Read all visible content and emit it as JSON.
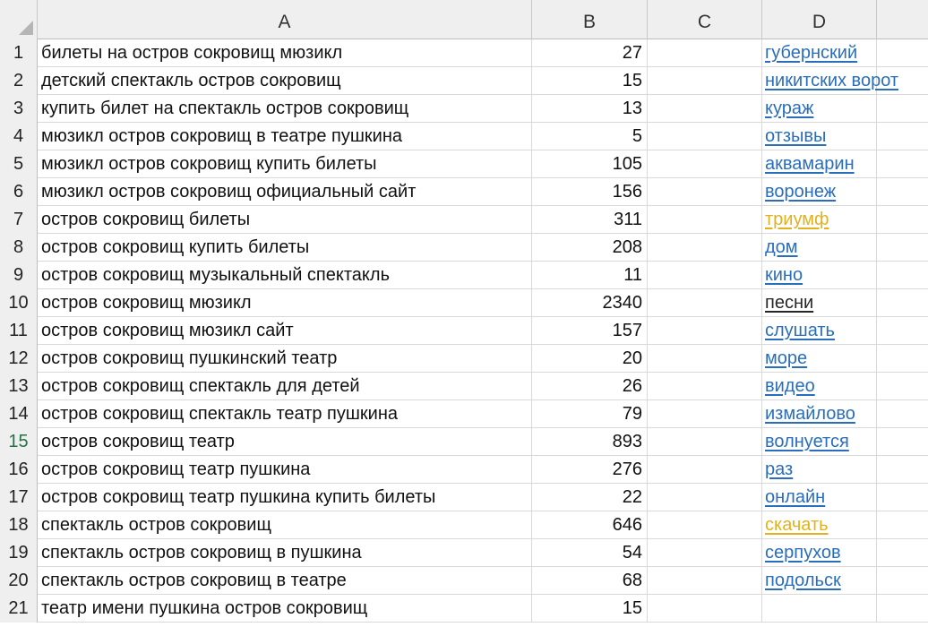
{
  "columns": [
    "",
    "A",
    "B",
    "C",
    "D",
    ""
  ],
  "active_row": 15,
  "colors": {
    "link_blue": "#2a6ebb",
    "link_gold": "#e2b21c",
    "link_dark": "#262626",
    "active_row_number": "#217346"
  },
  "rows": [
    {
      "num": "1",
      "a": "билеты на остров сокровищ мюзикл",
      "b": "27",
      "d": "губернский",
      "d_color": "#2a6ebb"
    },
    {
      "num": "2",
      "a": "детский спектакль остров сокровищ",
      "b": "15",
      "d": "никитских ворот",
      "d_color": "#2a6ebb"
    },
    {
      "num": "3",
      "a": "купить билет на спектакль остров сокровищ",
      "b": "13",
      "d": "кураж",
      "d_color": "#2a6ebb"
    },
    {
      "num": "4",
      "a": "мюзикл остров сокровищ в театре пушкина",
      "b": "5",
      "d": "отзывы",
      "d_color": "#2a6ebb"
    },
    {
      "num": "5",
      "a": "мюзикл остров сокровищ купить билеты",
      "b": "105",
      "d": "аквамарин",
      "d_color": "#2a6ebb"
    },
    {
      "num": "6",
      "a": "мюзикл остров сокровищ официальный сайт",
      "b": "156",
      "d": "воронеж",
      "d_color": "#2a6ebb"
    },
    {
      "num": "7",
      "a": "остров сокровищ билеты",
      "b": "311",
      "d": "триумф",
      "d_color": "#e2b21c"
    },
    {
      "num": "8",
      "a": "остров сокровищ купить билеты",
      "b": "208",
      "d": "дом",
      "d_color": "#2a6ebb"
    },
    {
      "num": "9",
      "a": "остров сокровищ музыкальный спектакль",
      "b": "11",
      "d": "кино",
      "d_color": "#2a6ebb"
    },
    {
      "num": "10",
      "a": "остров сокровищ мюзикл",
      "b": "2340",
      "d": "песни",
      "d_color": "#262626"
    },
    {
      "num": "11",
      "a": "остров сокровищ мюзикл сайт",
      "b": "157",
      "d": "слушать",
      "d_color": "#2a6ebb"
    },
    {
      "num": "12",
      "a": "остров сокровищ пушкинский театр",
      "b": "20",
      "d": "море",
      "d_color": "#2a6ebb"
    },
    {
      "num": "13",
      "a": "остров сокровищ спектакль для детей",
      "b": "26",
      "d": "видео",
      "d_color": "#2a6ebb"
    },
    {
      "num": "14",
      "a": "остров сокровищ спектакль театр пушкина",
      "b": "79",
      "d": "измайлово",
      "d_color": "#2a6ebb"
    },
    {
      "num": "15",
      "a": "остров сокровищ театр",
      "b": "893",
      "d": "волнуется",
      "d_color": "#2a6ebb"
    },
    {
      "num": "16",
      "a": "остров сокровищ театр пушкина",
      "b": "276",
      "d": "раз",
      "d_color": "#2a6ebb"
    },
    {
      "num": "17",
      "a": "остров сокровищ театр пушкина купить билеты",
      "b": "22",
      "d": "онлайн",
      "d_color": "#2a6ebb"
    },
    {
      "num": "18",
      "a": "спектакль остров сокровищ",
      "b": "646",
      "d": "скачать",
      "d_color": "#e2b21c"
    },
    {
      "num": "19",
      "a": "спектакль остров сокровищ в пушкина",
      "b": "54",
      "d": "серпухов",
      "d_color": "#2a6ebb"
    },
    {
      "num": "20",
      "a": "спектакль остров сокровищ в театре",
      "b": "68",
      "d": "подольск",
      "d_color": "#2a6ebb"
    },
    {
      "num": "21",
      "a": "театр имени пушкина остров сокровищ",
      "b": "15",
      "d": "",
      "d_color": "#2a6ebb"
    }
  ]
}
